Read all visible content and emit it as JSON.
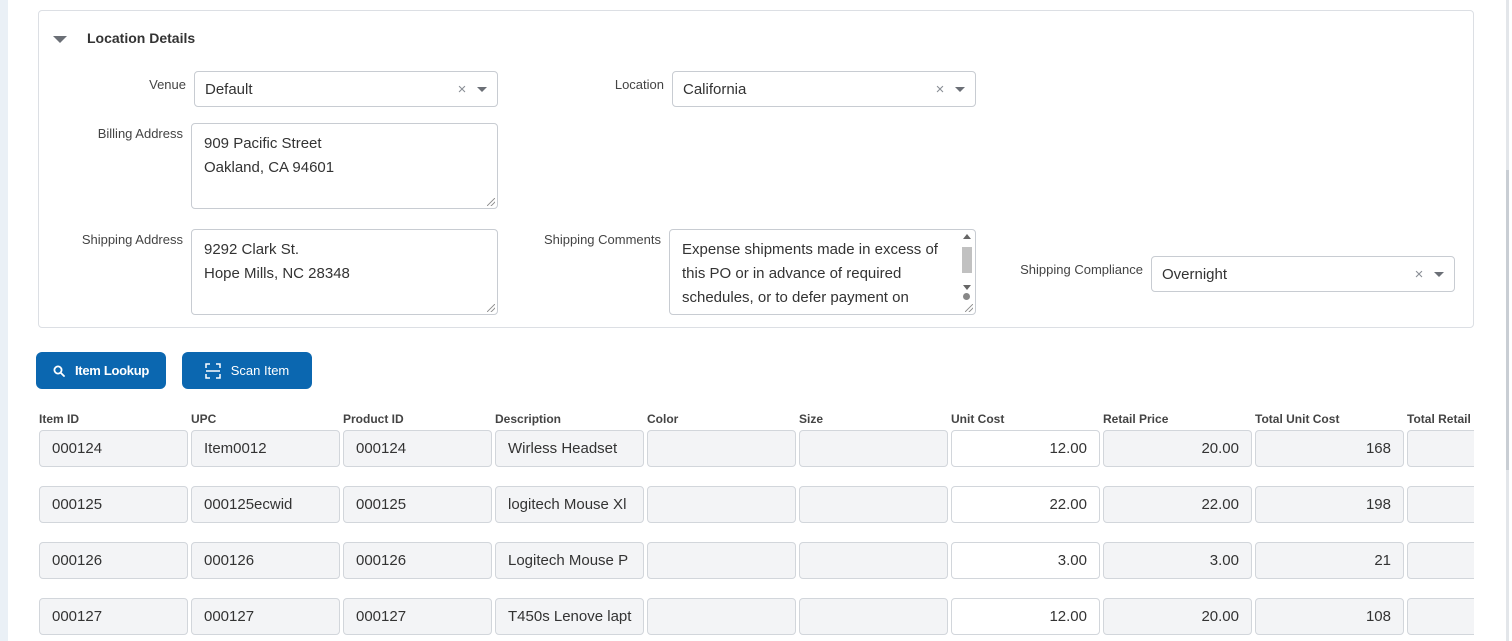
{
  "location_details": {
    "title": "Location Details",
    "venue": {
      "label": "Venue",
      "value": "Default"
    },
    "location": {
      "label": "Location",
      "value": "California"
    },
    "billing_address": {
      "label": "Billing Address",
      "lines": [
        "909 Pacific Street",
        "Oakland, CA 94601"
      ]
    },
    "shipping_address": {
      "label": "Shipping Address",
      "lines": [
        "9292 Clark St.",
        "Hope Mills, NC 28348"
      ]
    },
    "shipping_comments": {
      "label": "Shipping Comments",
      "lines": [
        "Expense shipments made in excess of",
        "this PO or in advance of required",
        "schedules, or to defer payment on"
      ]
    },
    "shipping_compliance": {
      "label": "Shipping Compliance",
      "value": "Overnight"
    },
    "clear_symbol": "×"
  },
  "buttons": {
    "item_lookup": "Item Lookup",
    "scan_item": "Scan Item"
  },
  "table": {
    "columns": [
      "Item ID",
      "UPC",
      "Product ID",
      "Description",
      "Color",
      "Size",
      "Unit Cost",
      "Retail Price",
      "Total Unit Cost",
      "Total Retail P"
    ],
    "rows": [
      {
        "item_id": "000124",
        "upc": "Item0012",
        "product_id": "000124",
        "description": "Wirless Headset",
        "color": "",
        "size": "",
        "unit_cost": "12.00",
        "retail_price": "20.00",
        "total_unit_cost": "168",
        "total_retail": ""
      },
      {
        "item_id": "000125",
        "upc": "000125ecwid",
        "product_id": "000125",
        "description": "logitech Mouse Xl",
        "color": "",
        "size": "",
        "unit_cost": "22.00",
        "retail_price": "22.00",
        "total_unit_cost": "198",
        "total_retail": ""
      },
      {
        "item_id": "000126",
        "upc": "000126",
        "product_id": "000126",
        "description": "Logitech Mouse P",
        "color": "",
        "size": "",
        "unit_cost": "3.00",
        "retail_price": "3.00",
        "total_unit_cost": "21",
        "total_retail": ""
      },
      {
        "item_id": "000127",
        "upc": "000127",
        "product_id": "000127",
        "description": "T450s Lenove lapt",
        "color": "",
        "size": "",
        "unit_cost": "12.00",
        "retail_price": "20.00",
        "total_unit_cost": "108",
        "total_retail": ""
      }
    ]
  },
  "colors": {
    "primary_button": "#0b67b0",
    "readonly_cell": "#f3f4f6",
    "border": "#c8ccd2"
  }
}
